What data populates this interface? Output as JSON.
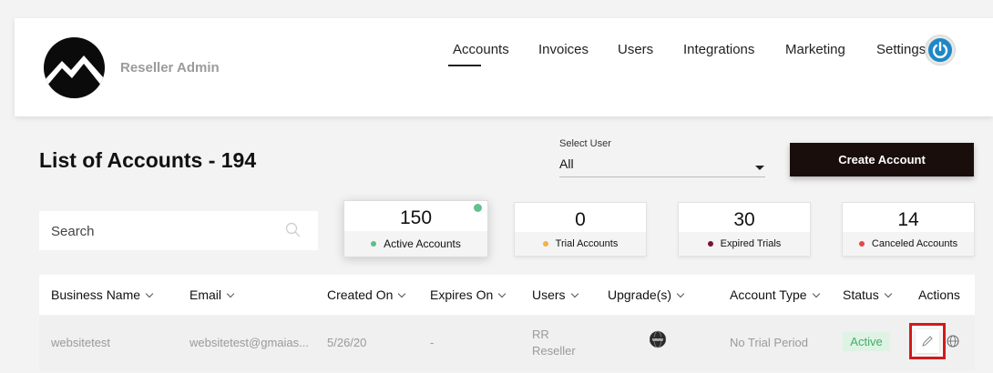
{
  "header": {
    "brand": "Reseller Admin",
    "nav": [
      "Accounts",
      "Invoices",
      "Users",
      "Integrations",
      "Marketing",
      "Settings"
    ],
    "active_nav": "Accounts"
  },
  "page": {
    "title": "List of Accounts - 194"
  },
  "filters": {
    "select_user_label": "Select User",
    "select_user_value": "All",
    "create_account_label": "Create Account",
    "search_placeholder": "Search"
  },
  "stats": [
    {
      "value": "150",
      "label": "Active Accounts",
      "color": "#5cbf85"
    },
    {
      "value": "0",
      "label": "Trial Accounts",
      "color": "#f1b24a"
    },
    {
      "value": "30",
      "label": "Expired Trials",
      "color": "#7a1237"
    },
    {
      "value": "14",
      "label": "Canceled Accounts",
      "color": "#e84545"
    }
  ],
  "table": {
    "columns": [
      "Business Name",
      "Email",
      "Created On",
      "Expires On",
      "Users",
      "Upgrade(s)",
      "Account Type",
      "Status",
      "Actions"
    ],
    "rows": [
      {
        "business_name": "websitetest",
        "email": "websitetest@gmaias...",
        "created_on": "5/26/20",
        "expires_on": "-",
        "users_line1": "RR",
        "users_line2": "Reseller",
        "upgrade_icon": "www-globe-icon",
        "account_type": "No Trial Period",
        "status": "Active"
      }
    ]
  },
  "colors": {
    "accent_dark": "#1a0e0c",
    "power_blue": "#1e88c7",
    "status_green": "#3fae66",
    "highlight_red": "#d21a1a"
  }
}
